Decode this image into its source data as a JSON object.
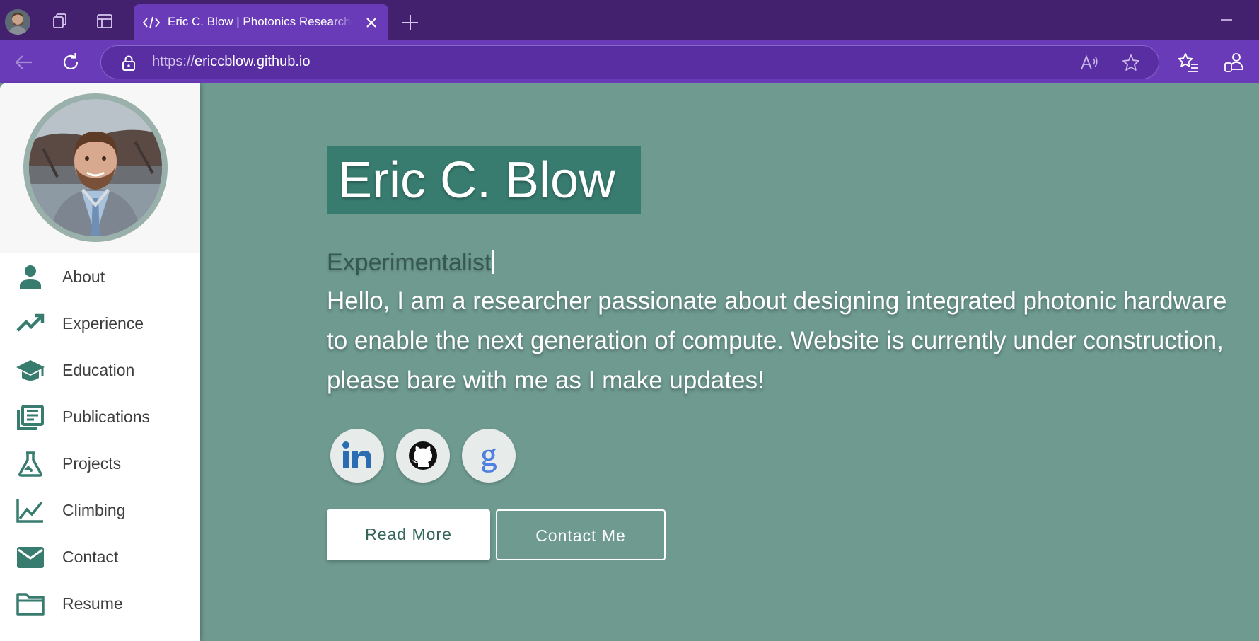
{
  "browser": {
    "tab_title": "Eric C. Blow | Photonics Researcher",
    "url_protocol": "https://",
    "url_host": "ericcblow.github.io",
    "accent": "#6a3bb8",
    "titlebar_color": "#44216f"
  },
  "icons": {
    "titlebar": [
      "profile-avatar",
      "workspaces-icon",
      "tab-actions-icon",
      "code-icon",
      "close-icon",
      "new-tab-icon"
    ],
    "navbar": [
      "back-icon",
      "refresh-icon",
      "lock-icon",
      "read-aloud-icon",
      "favorite-star-icon",
      "favorites-icon",
      "profile-share-icon"
    ]
  },
  "sidebar": {
    "items": [
      {
        "label": "About",
        "icon": "person-icon"
      },
      {
        "label": "Experience",
        "icon": "trending-up-icon"
      },
      {
        "label": "Education",
        "icon": "graduation-cap-icon"
      },
      {
        "label": "Publications",
        "icon": "library-books-icon"
      },
      {
        "label": "Projects",
        "icon": "flask-icon"
      },
      {
        "label": "Climbing",
        "icon": "line-chart-icon"
      },
      {
        "label": "Contact",
        "icon": "mail-icon"
      },
      {
        "label": "Resume",
        "icon": "folder-icon"
      }
    ],
    "icon_color": "#387c70"
  },
  "hero": {
    "name": "Eric C. Blow",
    "role": "Experimentalist",
    "intro": "Hello, I am a researcher passionate about designing integrated photonic hardware to enable the next generation of compute. Website is currently under construction, please bare with me as I make updates!",
    "social": [
      {
        "name": "linkedin",
        "icon": "linkedin-icon"
      },
      {
        "name": "github",
        "icon": "github-icon"
      },
      {
        "name": "google-scholar",
        "icon": "google-scholar-icon"
      }
    ],
    "read_more_label": "Read More",
    "contact_label": "Contact Me",
    "background": "#6e9a8f",
    "name_box_color": "#387c70"
  }
}
